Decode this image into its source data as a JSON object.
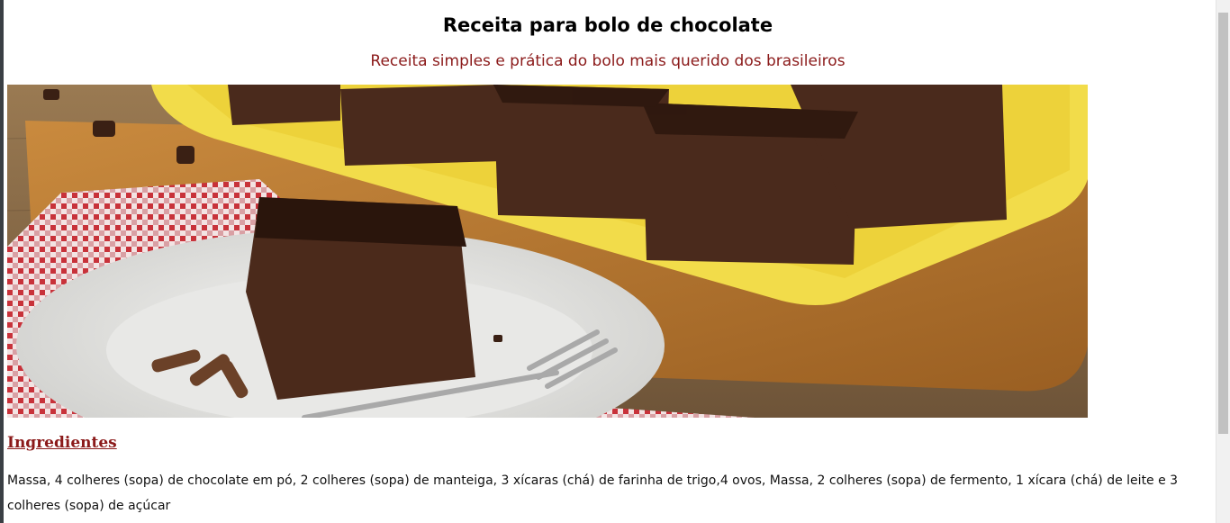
{
  "header": {
    "title": "Receita para bolo de chocolate",
    "subtitle": "Receita simples e prática do bolo mais querido dos brasileiros"
  },
  "hero_image": {
    "subject": "chocolate cake squares on a yellow tray and a white plate with a fork, red checkered napkin, wooden table"
  },
  "ingredients": {
    "heading": "Ingredientes",
    "text": "Massa, 4 colheres (sopa) de chocolate em pó, 2 colheres (sopa) de manteiga, 3 xícaras (chá) de farinha de trigo,4 ovos, Massa, 2 colheres (sopa) de fermento, 1 xícara (chá) de leite e 3 colheres (sopa) de açúcar"
  },
  "colors": {
    "accent": "#8b1a1a",
    "title": "#000000"
  }
}
